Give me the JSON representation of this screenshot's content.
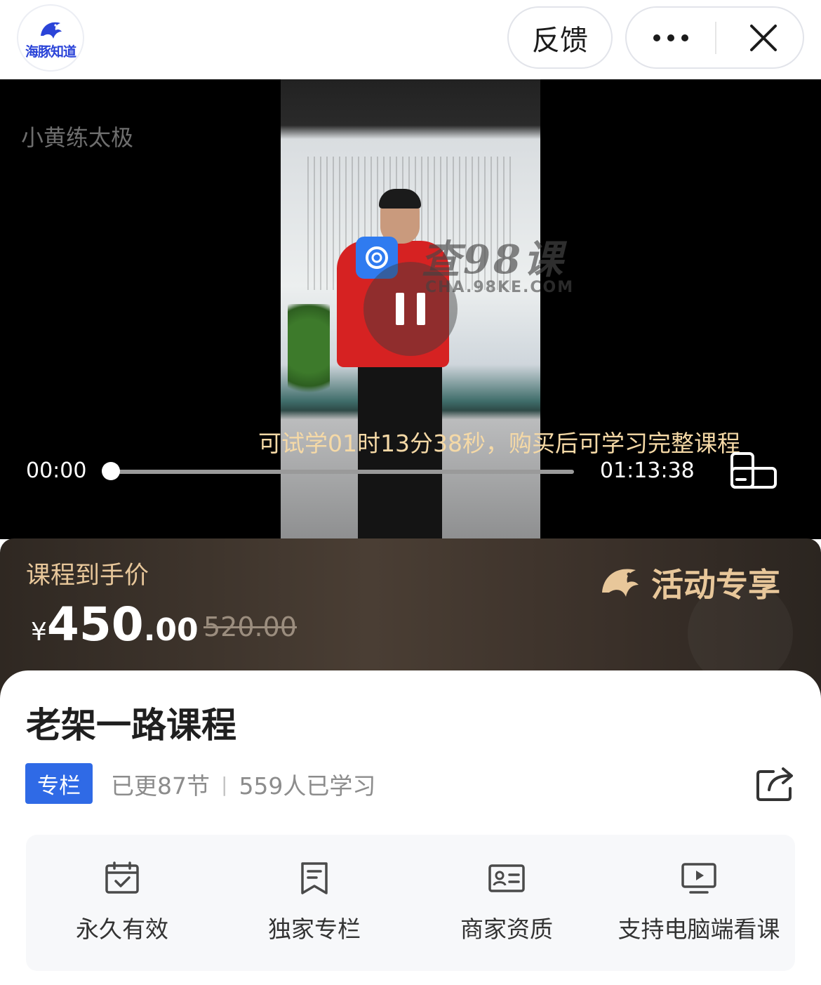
{
  "header": {
    "logo_text": "海豚知道",
    "feedback_label": "反馈",
    "more_icon": "more-dots-icon",
    "close_icon": "close-icon"
  },
  "video": {
    "title": "小黄练太极",
    "trial_notice": "可试学01时13分38秒，购买后可学习完整课程",
    "time_current": "00:00",
    "time_total": "01:13:38",
    "progress": 0,
    "state_icon": "pause-icon",
    "watermark": {
      "text": "查98课",
      "url_text": "CHA.98KE.COM"
    }
  },
  "price": {
    "label": "课程到手价",
    "currency": "¥",
    "current_int": "450",
    "current_dec": ".00",
    "original": "520.00",
    "promo_label": "活动专享"
  },
  "course": {
    "title": "老架一路课程",
    "tag": "专栏",
    "updated": "已更87节",
    "separator": "|",
    "learners": "559人已学习"
  },
  "features": [
    {
      "icon": "calendar-check-icon",
      "label": "永久有效"
    },
    {
      "icon": "bookmark-doc-icon",
      "label": "独家专栏"
    },
    {
      "icon": "id-card-icon",
      "label": "商家资质"
    },
    {
      "icon": "monitor-play-icon",
      "label": "支持电脑端看课"
    }
  ],
  "colors": {
    "accent_blue": "#2f6ae6",
    "brand_blue": "#2b44d8",
    "gold": "#e8c79a",
    "trial_text": "#f5d9a6"
  }
}
